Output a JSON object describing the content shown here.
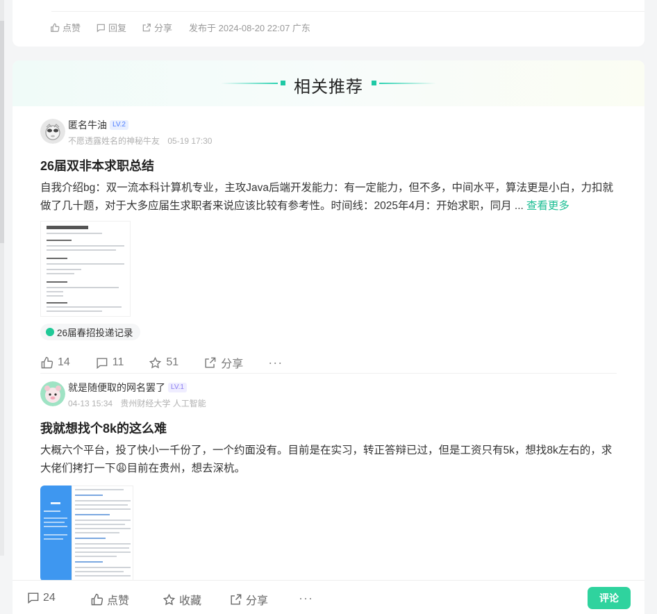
{
  "top_card": {
    "like_label": "点赞",
    "reply_label": "回复",
    "share_label": "分享",
    "published": "发布于 2024-08-20 22:07 广东"
  },
  "recommend": {
    "title": "相关推荐",
    "accent_color": "#1fc9a5"
  },
  "posts": [
    {
      "author": "匿名牛油",
      "level": "LV.2",
      "subtitle_name": "不愿透露姓名的神秘牛友",
      "time": "05-19 17:30",
      "title": "26届双非本求职总结",
      "body": "自我介绍bg：双一流本科计算机专业，主攻Java后端开发能力：有一定能力，但不多，中间水平，算法更是小白，力扣就做了几十题，对于大多应届生求职者来说应该比较有参考性。时间线：2025年4月：开始求职，同月 ...",
      "more": "查看更多",
      "tag": "26届春招投递记录",
      "likes": "14",
      "comments": "11",
      "stars": "51",
      "share": "分享"
    },
    {
      "author": "就是随便取的网名罢了",
      "level": "LV.1",
      "time": "04-13 15:34",
      "school": "贵州财经大学 人工智能",
      "title": "我就想找个8k的这么难",
      "body": "大概六个平台，投了快小一千份了，一个约面没有。目前是在实习，转正答辩已过，但是工资只有5k，想找8k左右的，求大佬们拷打一下😩目前在贵州，想去深杭。"
    }
  ],
  "bottom_bar": {
    "comments": "24",
    "like": "点赞",
    "collect": "收藏",
    "share": "分享",
    "comment_button": "评论",
    "button_color": "#2fd39e"
  }
}
